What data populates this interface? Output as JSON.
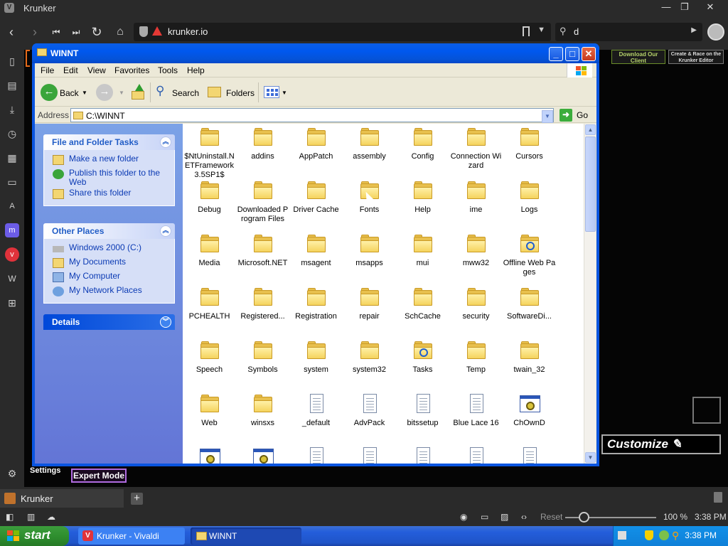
{
  "browser": {
    "title": "Krunker",
    "url": "krunker.io",
    "search_value": "d",
    "tab_label": "Krunker",
    "status": {
      "reset_label": "Reset",
      "zoom": "100 %",
      "time": "3:38 PM"
    }
  },
  "game": {
    "download_btn": "Download Our Client",
    "editor_btn": "Create & Race on the Krunker Editor",
    "customize": "Customize",
    "settings": "Settings",
    "expert_mode": "Expert Mode"
  },
  "explorer": {
    "title": "WINNT",
    "menu": [
      "File",
      "Edit",
      "View",
      "Favorites",
      "Tools",
      "Help"
    ],
    "toolbar": {
      "back": "Back",
      "search": "Search",
      "folders": "Folders"
    },
    "address": {
      "label": "Address",
      "value": "C:\\WINNT",
      "go": "Go"
    },
    "tasks": {
      "title": "File and Folder Tasks",
      "items": [
        "Make a new folder",
        "Publish this folder to the Web",
        "Share this folder"
      ]
    },
    "places": {
      "title": "Other Places",
      "items": [
        "Windows 2000 (C:)",
        "My Documents",
        "My Computer",
        "My Network Places"
      ]
    },
    "details": {
      "title": "Details"
    },
    "files": [
      {
        "name": "$NtUninstall.NETFramework3.5SP1$",
        "type": "folder"
      },
      {
        "name": "addins",
        "type": "folder"
      },
      {
        "name": "AppPatch",
        "type": "folder"
      },
      {
        "name": "assembly",
        "type": "folder"
      },
      {
        "name": "Config",
        "type": "folder"
      },
      {
        "name": "Connection Wizard",
        "type": "folder"
      },
      {
        "name": "Cursors",
        "type": "folder"
      },
      {
        "name": "Debug",
        "type": "folder"
      },
      {
        "name": "Downloaded Program Files",
        "type": "folder"
      },
      {
        "name": "Driver Cache",
        "type": "folder"
      },
      {
        "name": "Fonts",
        "type": "folder"
      },
      {
        "name": "Help",
        "type": "folder"
      },
      {
        "name": "ime",
        "type": "folder"
      },
      {
        "name": "Logs",
        "type": "folder"
      },
      {
        "name": "Media",
        "type": "folder"
      },
      {
        "name": "Microsoft.NET",
        "type": "folder"
      },
      {
        "name": "msagent",
        "type": "folder"
      },
      {
        "name": "msapps",
        "type": "folder"
      },
      {
        "name": "mui",
        "type": "folder"
      },
      {
        "name": "mww32",
        "type": "folder"
      },
      {
        "name": "Offline Web Pages",
        "type": "special"
      },
      {
        "name": "PCHEALTH",
        "type": "folder"
      },
      {
        "name": "Registered...",
        "type": "folder"
      },
      {
        "name": "Registration",
        "type": "folder"
      },
      {
        "name": "repair",
        "type": "folder"
      },
      {
        "name": "SchCache",
        "type": "folder"
      },
      {
        "name": "security",
        "type": "folder"
      },
      {
        "name": "SoftwareDi...",
        "type": "folder"
      },
      {
        "name": "Speech",
        "type": "folder"
      },
      {
        "name": "Symbols",
        "type": "folder"
      },
      {
        "name": "system",
        "type": "folder"
      },
      {
        "name": "system32",
        "type": "folder"
      },
      {
        "name": "Tasks",
        "type": "special"
      },
      {
        "name": "Temp",
        "type": "folder"
      },
      {
        "name": "twain_32",
        "type": "folder"
      },
      {
        "name": "Web",
        "type": "folder"
      },
      {
        "name": "winsxs",
        "type": "folder"
      },
      {
        "name": "_default",
        "type": "doc"
      },
      {
        "name": "AdvPack",
        "type": "doc"
      },
      {
        "name": "bitssetup",
        "type": "doc"
      },
      {
        "name": "Blue Lace 16",
        "type": "doc"
      },
      {
        "name": "ChOwnD",
        "type": "app"
      },
      {
        "name": "",
        "type": "app"
      },
      {
        "name": "",
        "type": "app"
      },
      {
        "name": "",
        "type": "doc"
      },
      {
        "name": "",
        "type": "doc"
      },
      {
        "name": "",
        "type": "doc"
      },
      {
        "name": "",
        "type": "doc"
      },
      {
        "name": "",
        "type": "doc"
      }
    ]
  },
  "taskbar": {
    "start": "start",
    "buttons": [
      "Krunker - Vivaldi",
      "WINNT"
    ],
    "clock": "3:38 PM"
  }
}
